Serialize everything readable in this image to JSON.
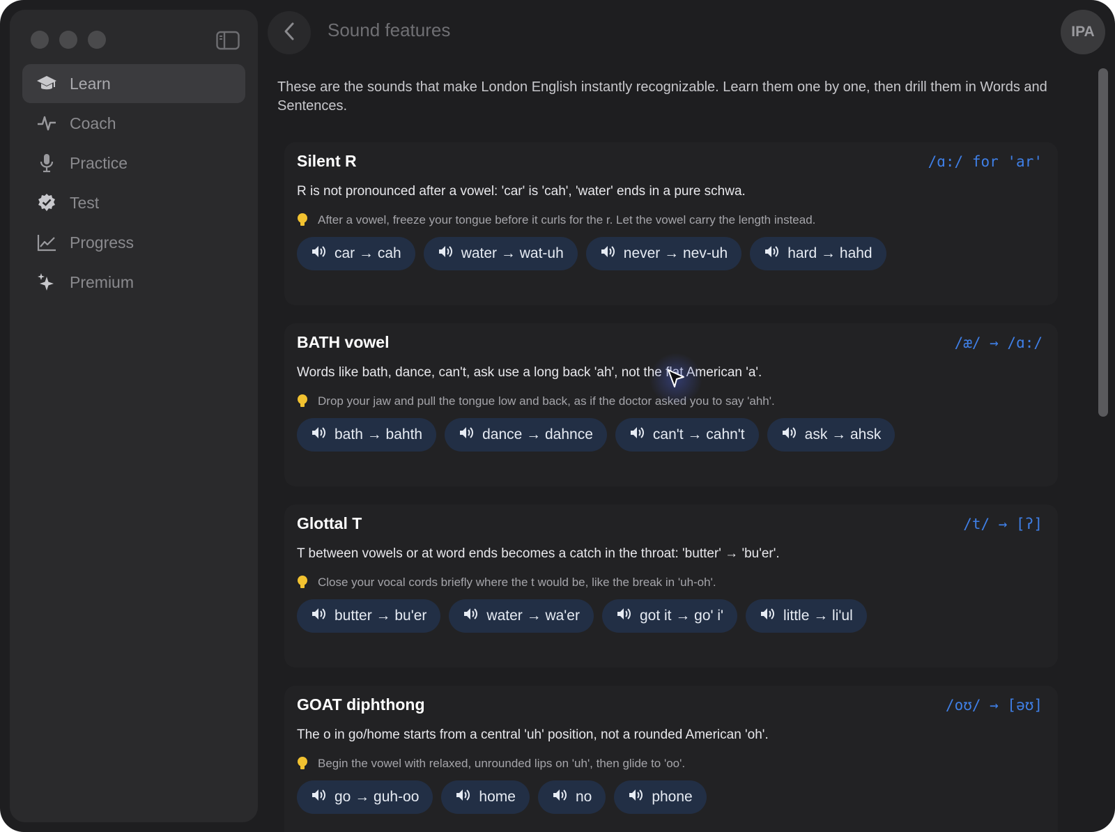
{
  "header": {
    "title": "Sound features",
    "avatar_label": "IPA"
  },
  "sidebar": {
    "items": [
      {
        "label": "Learn",
        "icon": "graduation-cap-icon",
        "active": true
      },
      {
        "label": "Coach",
        "icon": "waveform-pulse-icon",
        "active": false
      },
      {
        "label": "Practice",
        "icon": "microphone-icon",
        "active": false
      },
      {
        "label": "Test",
        "icon": "checkmark-seal-icon",
        "active": false
      },
      {
        "label": "Progress",
        "icon": "line-chart-icon",
        "active": false
      },
      {
        "label": "Premium",
        "icon": "sparkles-icon",
        "active": false
      }
    ]
  },
  "main": {
    "intro": "These are the sounds that make London English instantly recognizable. Learn them one by one, then drill them in Words and Sentences.",
    "features": [
      {
        "title": "Silent R",
        "ipa": "/ɑ:/ for 'ar'",
        "description": "R is not pronounced after a vowel: 'car' is 'cah', 'water' ends in a pure schwa.",
        "tip": "After a vowel, freeze your tongue before it curls for the r. Let the vowel carry the length instead.",
        "examples": [
          "car → cah",
          "water → wat-uh",
          "never → nev-uh",
          "hard → hahd"
        ]
      },
      {
        "title": "BATH vowel",
        "ipa": "/æ/ → /ɑ:/",
        "description": "Words like bath, dance, can't, ask use a long back 'ah', not the flat American 'a'.",
        "tip": "Drop your jaw and pull the tongue low and back, as if the doctor asked you to say 'ahh'.",
        "examples": [
          "bath → bahth",
          "dance → dahnce",
          "can't → cahn't",
          "ask → ahsk"
        ]
      },
      {
        "title": "Glottal T",
        "ipa": "/t/ → [ʔ]",
        "description": "T between vowels or at word ends becomes a catch in the throat: 'butter' → 'bu'er'.",
        "tip": "Close your vocal cords briefly where the t would be, like the break in 'uh-oh'.",
        "examples": [
          "butter → bu'er",
          "water → wa'er",
          "got it → go' i'",
          "little → li'ul"
        ]
      },
      {
        "title": "GOAT diphthong",
        "ipa": "/oʊ/ → [əʊ]",
        "description": "The o in go/home starts from a central 'uh' position, not a rounded American 'oh'.",
        "tip": "Begin the vowel with relaxed, unrounded lips on 'uh', then glide to 'oo'.",
        "examples": [
          "go → guh-oo",
          "home",
          "no",
          "phone"
        ]
      }
    ]
  },
  "colors": {
    "window_bg": "#1e1e20",
    "sidebar_bg": "#2a2a2c",
    "chip_bg": "#222f45",
    "ipa_accent": "#3f7fe6",
    "tip_bulb": "#f2c230"
  }
}
